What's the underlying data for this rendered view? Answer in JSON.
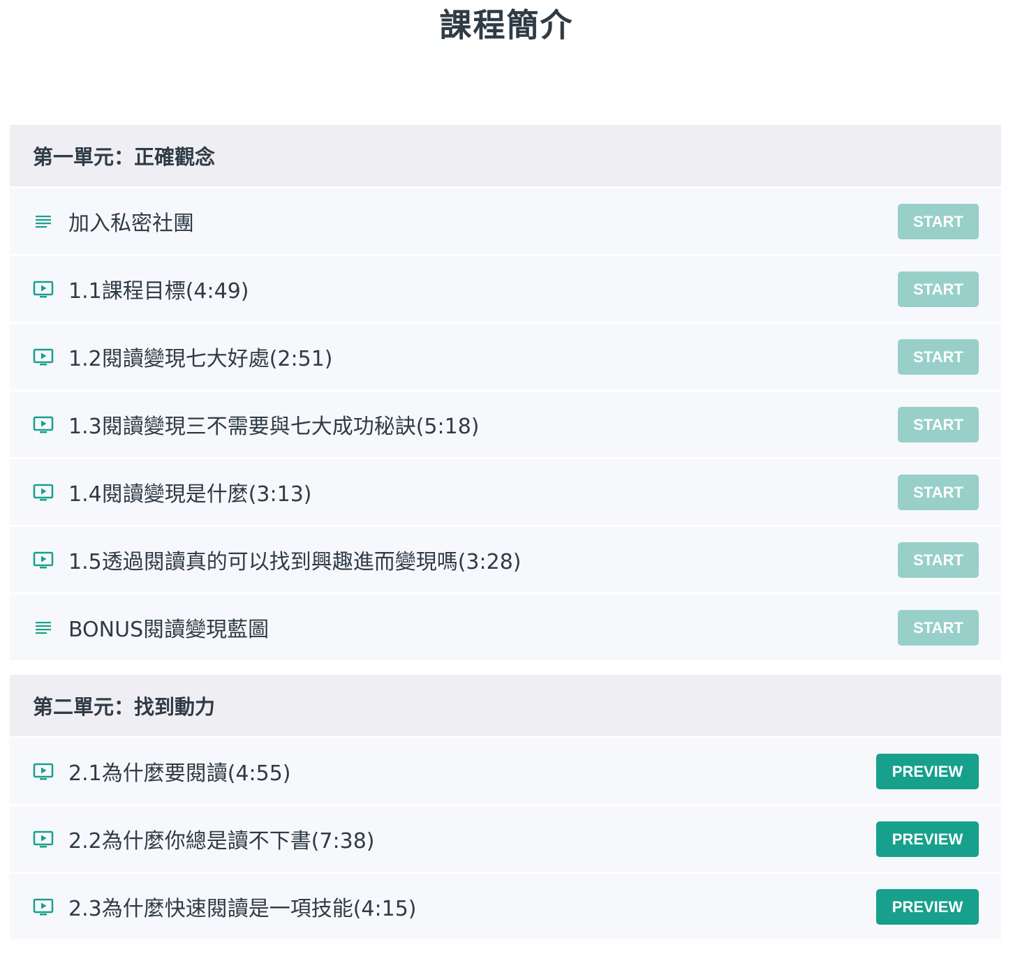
{
  "page": {
    "title": "課程簡介"
  },
  "colors": {
    "accent": "#17a08c",
    "start_button": "#98d0c9",
    "section_header_bg": "#efeff3",
    "row_bg": "#f7f8fc",
    "text": "#2f3b45"
  },
  "sections": [
    {
      "title": "第一單元：正確觀念",
      "lectures": [
        {
          "icon": "text-lines-icon",
          "title": "加入私密社團",
          "button": "START",
          "button_type": "start"
        },
        {
          "icon": "video-play-icon",
          "title": "1.1課程目標(4:49)",
          "button": "START",
          "button_type": "start"
        },
        {
          "icon": "video-play-icon",
          "title": "1.2閱讀變現七大好處(2:51)",
          "button": "START",
          "button_type": "start"
        },
        {
          "icon": "video-play-icon",
          "title": "1.3閱讀變現三不需要與七大成功秘訣(5:18)",
          "button": "START",
          "button_type": "start"
        },
        {
          "icon": "video-play-icon",
          "title": "1.4閱讀變現是什麼(3:13)",
          "button": "START",
          "button_type": "start"
        },
        {
          "icon": "video-play-icon",
          "title": "1.5透過閱讀真的可以找到興趣進而變現嗎(3:28)",
          "button": "START",
          "button_type": "start"
        },
        {
          "icon": "text-lines-icon",
          "title": "BONUS閱讀變現藍圖",
          "button": "START",
          "button_type": "start"
        }
      ]
    },
    {
      "title": "第二單元：找到動力",
      "lectures": [
        {
          "icon": "video-play-icon",
          "title": "2.1為什麼要閱讀(4:55)",
          "button": "PREVIEW",
          "button_type": "preview"
        },
        {
          "icon": "video-play-icon",
          "title": "2.2為什麼你總是讀不下書(7:38)",
          "button": "PREVIEW",
          "button_type": "preview"
        },
        {
          "icon": "video-play-icon",
          "title": "2.3為什麼快速閱讀是一項技能(4:15)",
          "button": "PREVIEW",
          "button_type": "preview"
        }
      ]
    }
  ]
}
